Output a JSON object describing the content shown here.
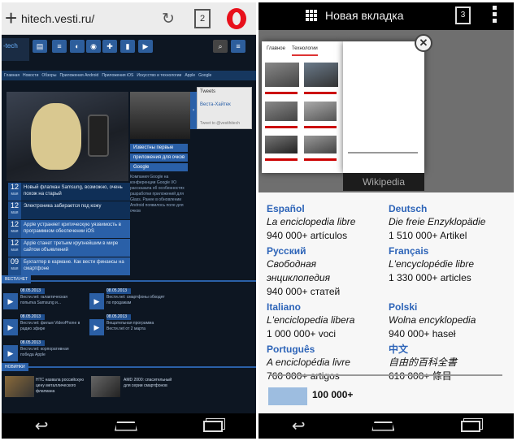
{
  "browser": {
    "url": "hitech.vesti.ru/",
    "tab_count": "2",
    "site": {
      "logo": "-tech",
      "top_icons": [
        "▤",
        "≡",
        "◐",
        "◉",
        "✚",
        "▮",
        "▶"
      ],
      "nav_items": [
        "Главная",
        "Новости",
        "Обзоры",
        "Приложения Android",
        "Приложения iOS",
        "Искусство и технологии",
        "Apple",
        "Google"
      ],
      "twitter": {
        "title": "Tweets",
        "name": "Веста-Хайтек",
        "footer": "Tweet to @vestihitech"
      },
      "side_links": [
        "Известны первые",
        "приложения для очков",
        "Google"
      ],
      "pane_text": "Компания Google на конференции Google I/O рассказала об особенностях разработки приложений для Glass. Ранее в обновлении Android появилось поле для очков",
      "news": [
        {
          "day": "12",
          "month": "мая",
          "title": "Новый флагман Samsung, возможно, очень похож на старый"
        },
        {
          "day": "12",
          "month": "мая",
          "title": "Электроника забирается под кожу"
        },
        {
          "day": "12",
          "month": "мая",
          "title": "Apple устраняет критическую уязвимость в программном обеспечении iOS"
        },
        {
          "day": "12",
          "month": "мая",
          "title": "Apple станет третьим крупнейшим в мире сайтом объявлений"
        },
        {
          "day": "09",
          "month": "мая",
          "title": "Бухгалтер в кармане. Как вести финансы на смартфоне"
        }
      ],
      "video_tag": "ВЕСТИ.НЕТ",
      "videos": [
        {
          "date": "08.05.2013",
          "title": "Вести.net: галактическая попытка Samsung и..."
        },
        {
          "date": "08.05.2013",
          "title": "Вести.net: смартфоны обходят по продажам"
        },
        {
          "date": "08.05.2013",
          "title": "Вести.net: фильм VideoPhone в радио эфире"
        },
        {
          "date": "08.05.2013",
          "title": "Вещательная программа Вести.net от 2 марта"
        },
        {
          "date": "08.05.2013",
          "title": "Вести.net: корпоративная победа Apple"
        }
      ],
      "bottom_tag": "НОВИНКИ",
      "bottom_items": [
        "HTC назвала российскую цену металлического флагмана",
        "AMD 2000: спасительный для серии смартфонов"
      ]
    }
  },
  "tabs_view": {
    "title": "Новая вкладка",
    "tab_count": "3",
    "card_label": "Wikipedia",
    "card1_tabs": [
      "Главное",
      "Технологии"
    ],
    "languages": [
      {
        "name": "Español",
        "slogan": "La enciclopedia libre",
        "count": "940 000+ artículos"
      },
      {
        "name": "Deutsch",
        "slogan": "Die freie Enzyklopädie",
        "count": "1 510 000+ Artikel"
      },
      {
        "name": "Русский",
        "slogan": "Свободная энциклопедия",
        "count": "940 000+ статей"
      },
      {
        "name": "Français",
        "slogan": "L'encyclopédie libre",
        "count": "1 330 000+ articles"
      },
      {
        "name": "Italiano",
        "slogan": "L'enciclopedia libera",
        "count": "1 000 000+ voci"
      },
      {
        "name": "Polski",
        "slogan": "Wolna encyklopedia",
        "count": "940 000+ haseł"
      },
      {
        "name": "Português",
        "slogan": "A enciclopédia livre",
        "count": "760 000+ artigos"
      },
      {
        "name": "中文",
        "slogan": "自由的百科全書",
        "count": "610 000+ 條目"
      }
    ],
    "total": "100 000+"
  },
  "colors": {
    "accent": "#2a60a8",
    "link": "#2d64b8",
    "opera": "#e8101b"
  }
}
